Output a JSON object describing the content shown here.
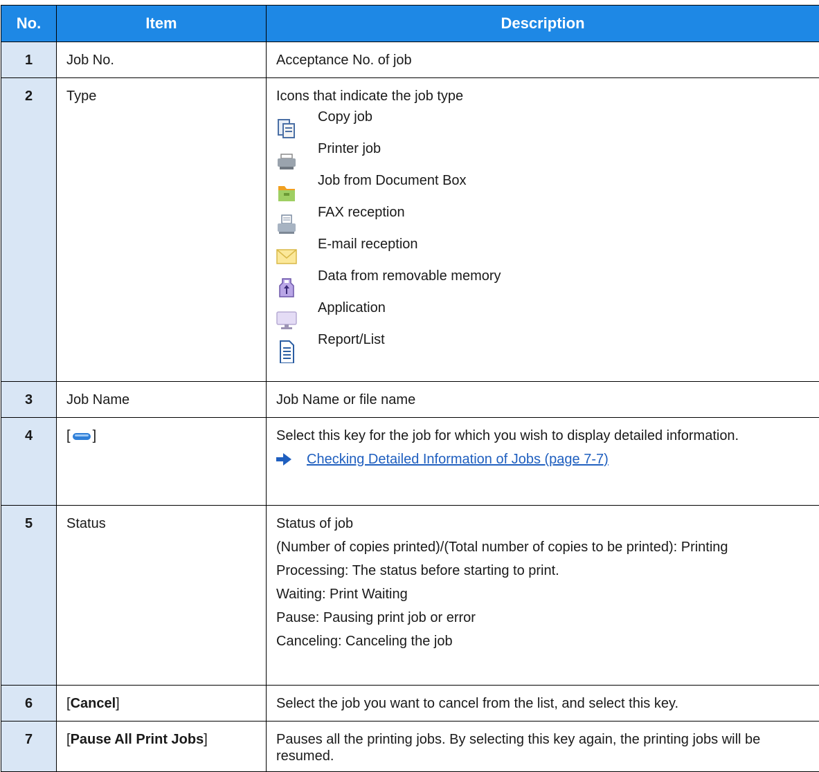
{
  "header": {
    "no": "No.",
    "item": "Item",
    "description": "Description"
  },
  "rows": [
    {
      "no": "1",
      "item": "Job No.",
      "desc": "Acceptance No. of job"
    },
    {
      "no": "2",
      "item": "Type",
      "desc": "Icons that indicate the job type",
      "types": [
        {
          "icon": "copy-job-icon",
          "label": "Copy job"
        },
        {
          "icon": "printer-job-icon",
          "label": "Printer job"
        },
        {
          "icon": "document-box-icon",
          "label": "Job from Document Box"
        },
        {
          "icon": "fax-reception-icon",
          "label": "FAX reception"
        },
        {
          "icon": "email-reception-icon",
          "label": "E-mail reception"
        },
        {
          "icon": "removable-memory-icon",
          "label": "Data from removable memory"
        },
        {
          "icon": "application-icon",
          "label": "Application"
        },
        {
          "icon": "report-list-icon",
          "label": "Report/List"
        }
      ]
    },
    {
      "no": "3",
      "item": "Job Name",
      "desc": "Job Name or file name"
    },
    {
      "no": "4",
      "item_open": "[",
      "item_icon": "detail-key-icon",
      "item_close": "]",
      "desc": "Select this key for the job for which you wish to display detailed information.",
      "link": "Checking Detailed Information of Jobs (page 7-7)"
    },
    {
      "no": "5",
      "item": "Status",
      "lines": [
        "Status of job",
        "(Number of copies printed)/(Total number of copies to be printed): Printing",
        "Processing: The status before starting to print.",
        "Waiting: Print Waiting",
        "Pause: Pausing print job or error",
        "Canceling: Canceling the job"
      ]
    },
    {
      "no": "6",
      "item_open": "[",
      "item_key": "Cancel",
      "item_close": "]",
      "desc": "Select the job you want to cancel from the list, and select this key."
    },
    {
      "no": "7",
      "item_open": "[",
      "item_key": "Pause All Print Jobs",
      "item_close": "]",
      "desc": "Pauses all the printing jobs. By selecting this key again, the printing jobs will be resumed."
    }
  ],
  "colors": {
    "header_bg": "#1e88e5",
    "number_bg": "#d9e6f5",
    "link": "#1f5fbf"
  }
}
